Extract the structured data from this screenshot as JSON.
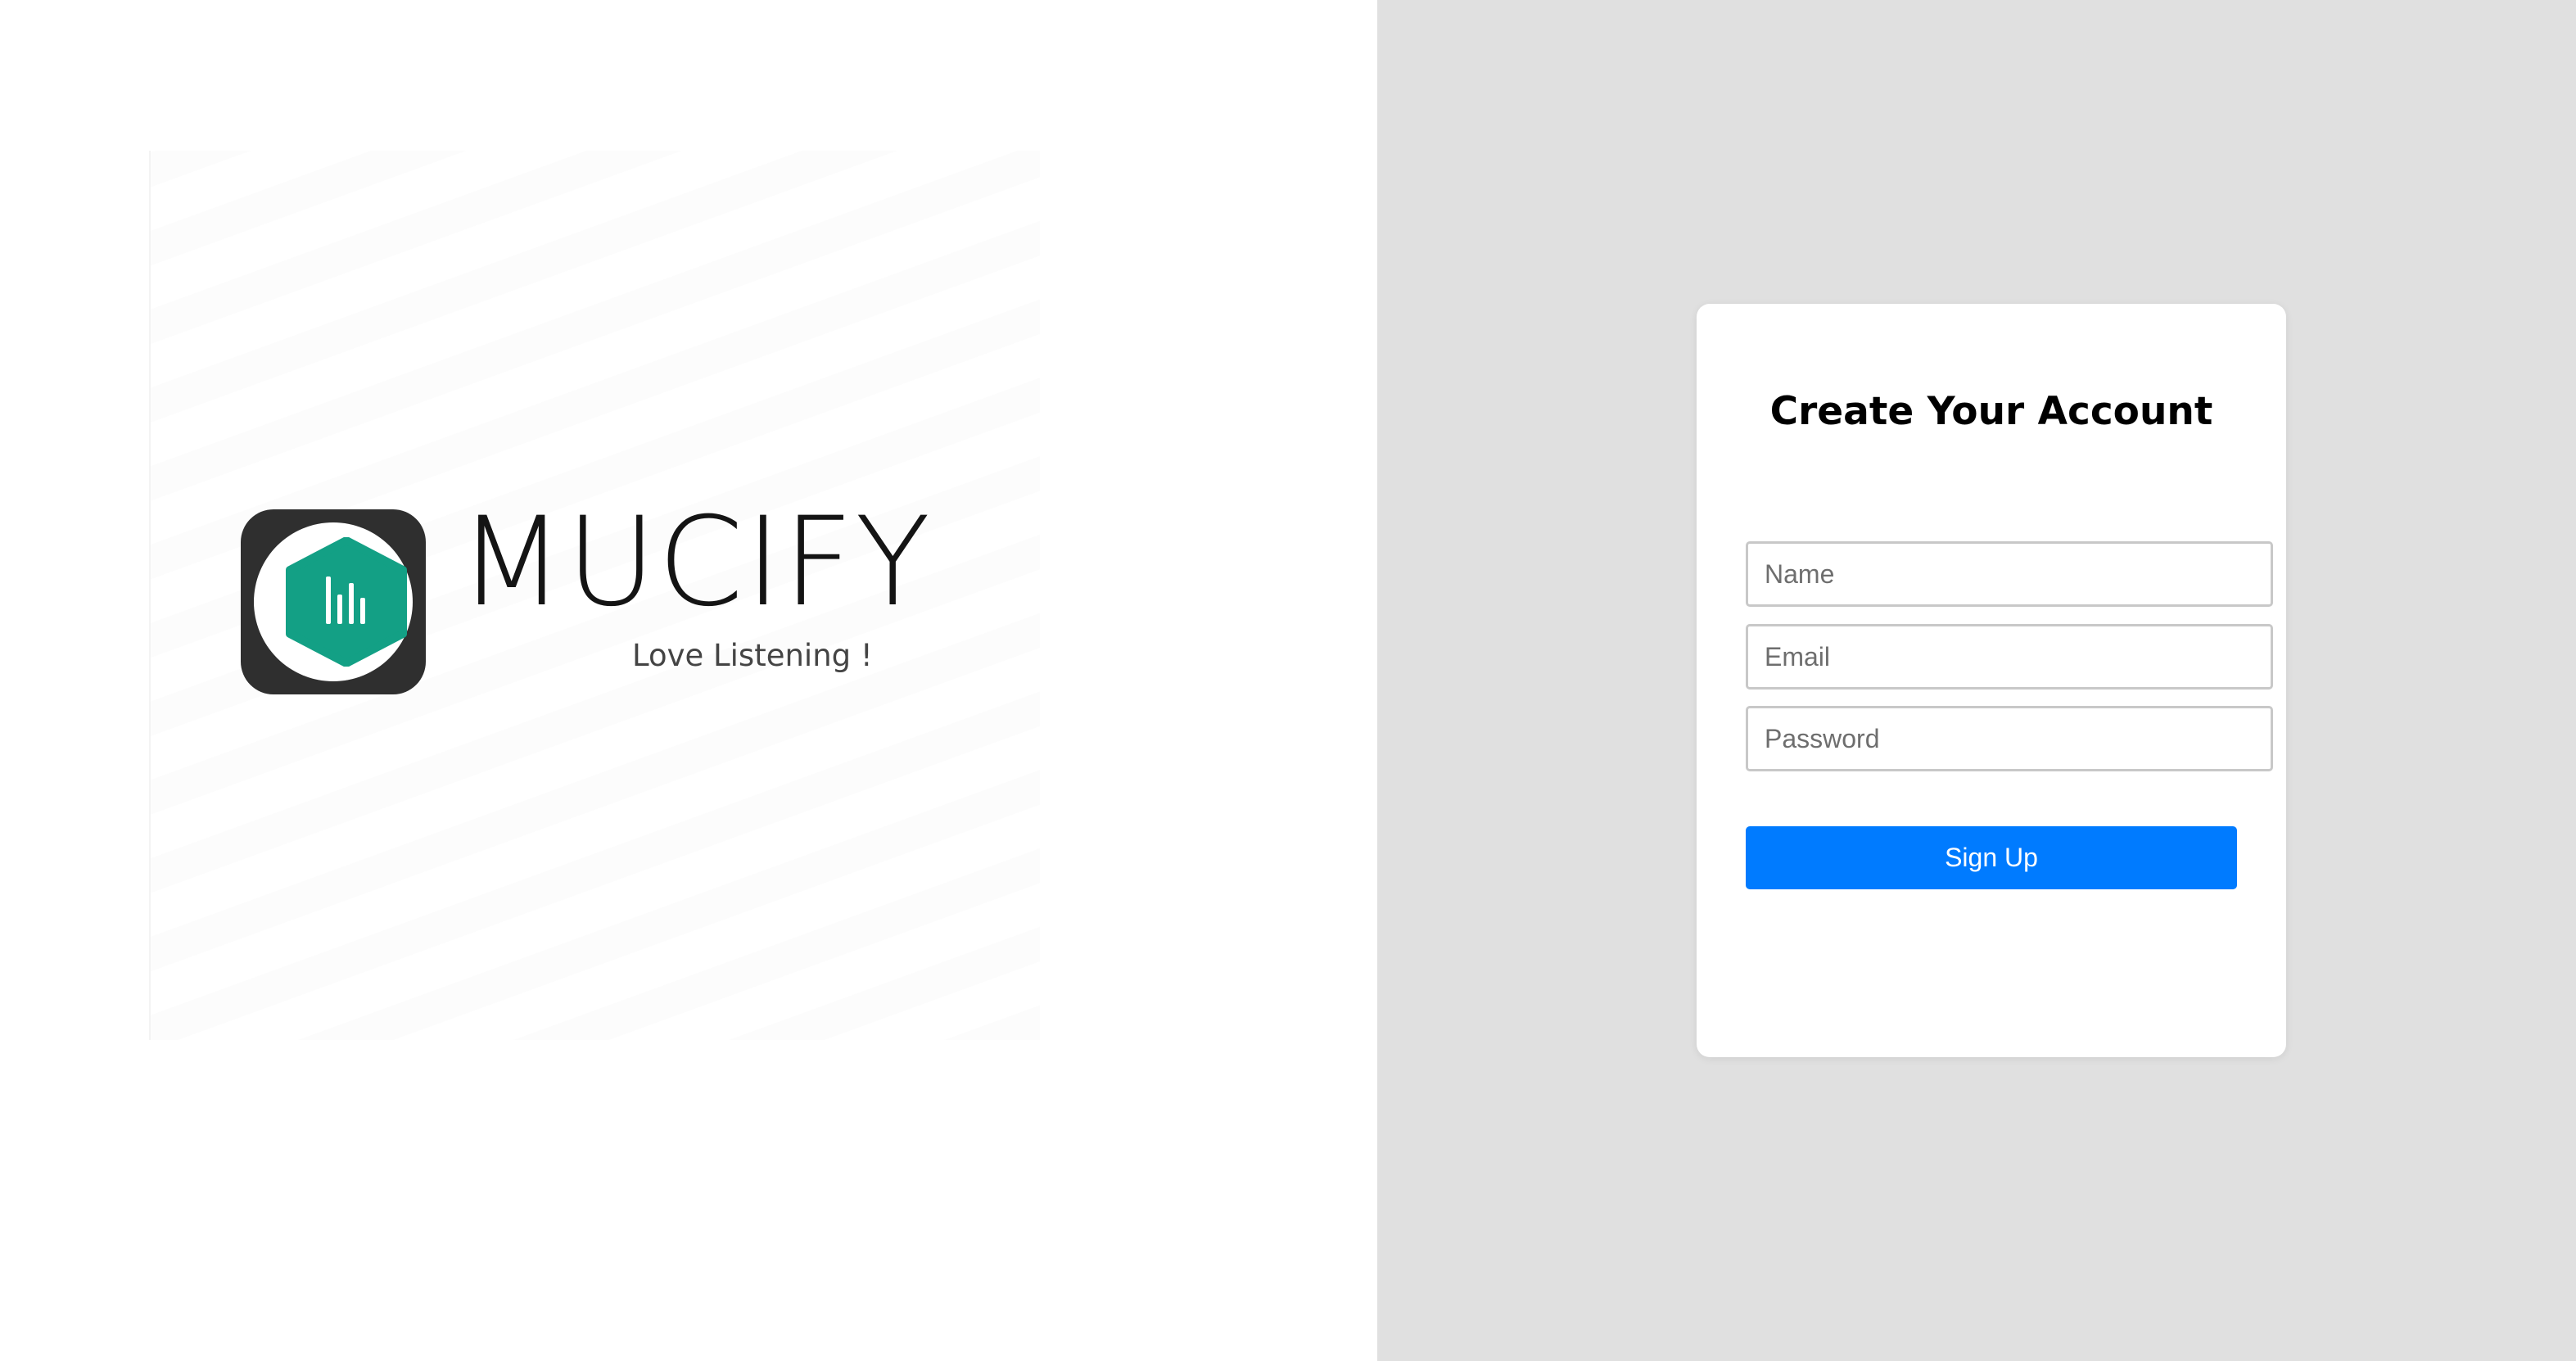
{
  "brand": {
    "name": "MUCIFY",
    "tagline": "Love Listening !",
    "icon": "equalizer-hexagon-icon",
    "colors": {
      "icon_frame": "#2f2f2f",
      "icon_hexagon": "#13a085"
    }
  },
  "signup": {
    "title": "Create Your Account",
    "name_placeholder": "Name",
    "email_placeholder": "Email",
    "password_placeholder": "Password",
    "submit_label": "Sign Up"
  },
  "colors": {
    "left_background": "#ffffff",
    "right_background": "#e0e0e0",
    "primary_button": "#007bff"
  }
}
